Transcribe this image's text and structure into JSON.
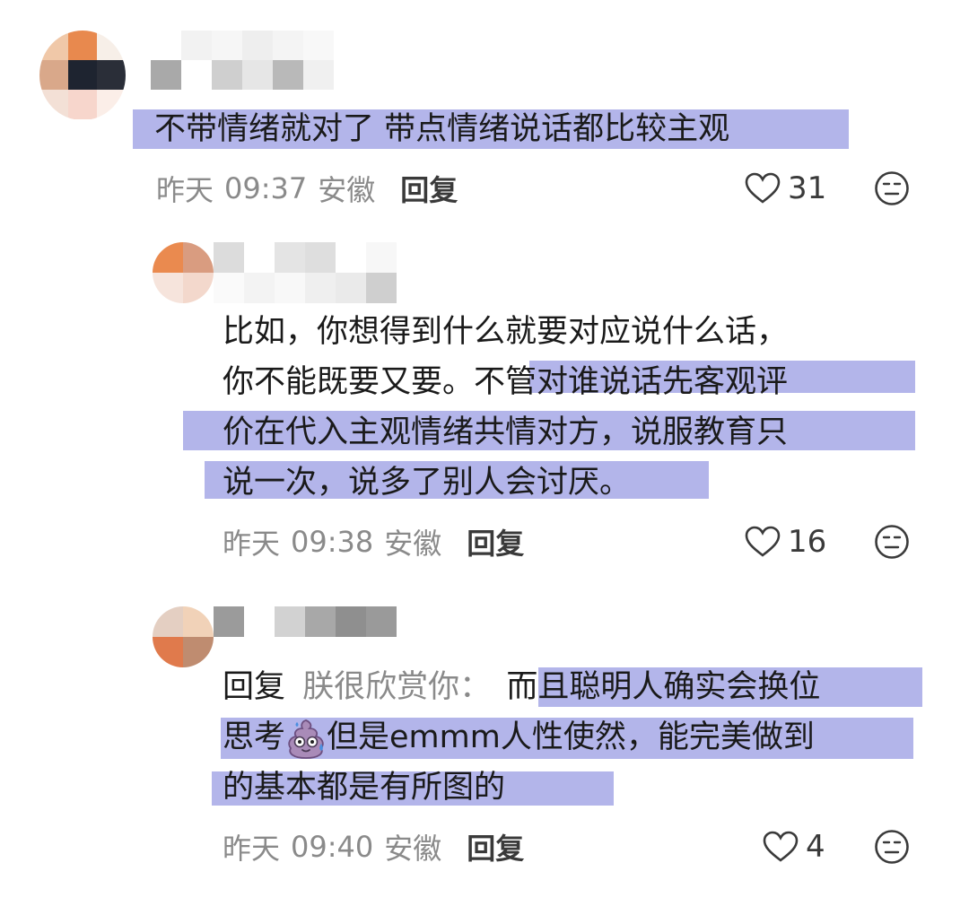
{
  "comments": [
    {
      "text_lines": [
        "不带情绪就对了 带点情绪说话都比较主观"
      ],
      "date": "昨天",
      "time": "09:37",
      "location": "安徽",
      "reply_label": "回复",
      "likes": "31"
    },
    {
      "text_lines": [
        "比如，你想得到什么就要对应说什么话，",
        "你不能既要又要。不管对谁说话先客观评",
        "价在代入主观情绪共情对方，说服教育只",
        "说一次，说多了别人会讨厌。"
      ],
      "date": "昨天",
      "time": "09:38",
      "location": "安徽",
      "reply_label": "回复",
      "likes": "16"
    },
    {
      "reply_prefix": "回复",
      "reply_target": "朕很欣赏你：",
      "text_lines": [
        "而且聪明人确实会换位",
        "思考",
        "但是emmm人性使然，能完美做到",
        "的基本都是有所图的"
      ],
      "date": "昨天",
      "time": "09:40",
      "location": "安徽",
      "reply_label": "回复",
      "likes": "4"
    }
  ],
  "icons": {
    "like": "heart-outline-icon",
    "dislike": "neutral-face-icon",
    "emoji": "poop-emoji-icon"
  },
  "colors": {
    "highlight": "#b3b5ea",
    "meta_text": "#8a8a8a",
    "body_text": "#1a1a1a"
  }
}
